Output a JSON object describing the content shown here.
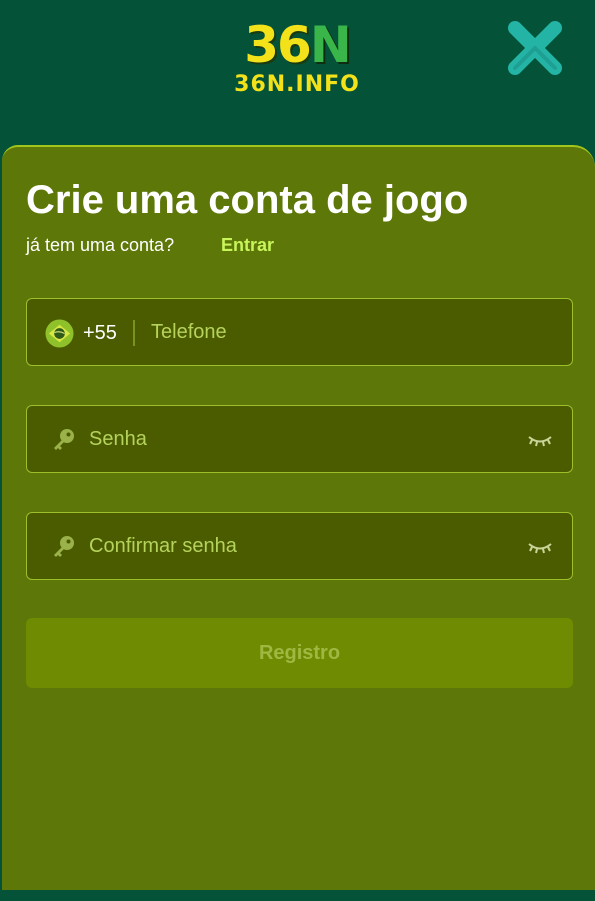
{
  "header": {
    "logo_main_digits": "36",
    "logo_main_letter": "N",
    "logo_sub": "36N.INFO",
    "close_icon": "close-icon"
  },
  "form": {
    "title": "Crie uma conta de jogo",
    "subtitle": "já tem uma conta?",
    "login_link": "Entrar",
    "phone": {
      "flag_icon": "brazil-flag-icon",
      "dial_code": "+55",
      "placeholder": "Telefone",
      "value": ""
    },
    "password": {
      "icon": "key-icon",
      "placeholder": "Senha",
      "value": "",
      "toggle_icon": "eye-closed-icon"
    },
    "confirm_password": {
      "icon": "key-icon",
      "placeholder": "Confirmar senha",
      "value": "",
      "toggle_icon": "eye-closed-icon"
    },
    "register_label": "Registro"
  },
  "colors": {
    "header_bg": "#045338",
    "card_bg": "#5d7708",
    "accent": "#c7f55a",
    "logo_yellow": "#f3e21a",
    "logo_green": "#39b54a",
    "close_teal": "#24b4a6"
  }
}
